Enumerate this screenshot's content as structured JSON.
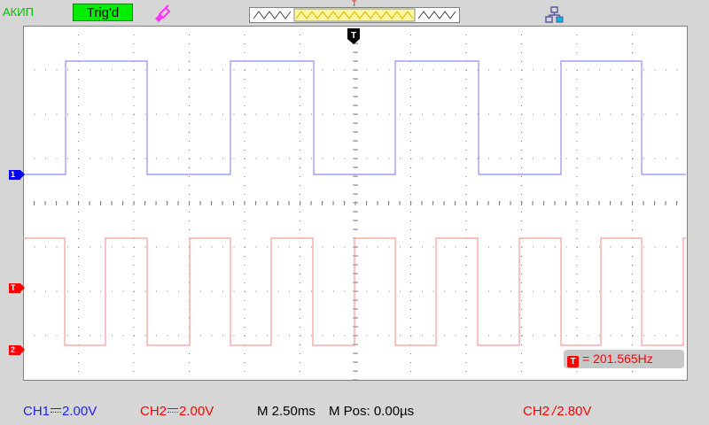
{
  "header": {
    "mode": "АКИП",
    "trigger_status": "Trig'd",
    "trigger_position_marker": "T"
  },
  "screen": {
    "channel_markers": {
      "ch1": "1",
      "trigger": "T",
      "ch2": "2"
    },
    "trigger_pointer": "T"
  },
  "frequency": {
    "icon": "T",
    "value": "= 201.565Hz"
  },
  "status": {
    "ch1_label": "CH1",
    "ch1_scale": "2.00V",
    "ch2_label": "CH2",
    "ch2_scale": "2.00V",
    "timebase": "M 2.50ms",
    "mpos": "M Pos: 0.00µs",
    "trigger_source": "CH2",
    "trigger_level": "2.80V"
  },
  "colors": {
    "ch1": "#8c8cff",
    "ch2": "#ff9a9a",
    "grid": "#808080",
    "brand": "#00c000",
    "accent_red": "#ff0000"
  },
  "icons": [
    "probe-icon",
    "network-icon",
    "trigger-pointer-icon",
    "memory-bar"
  ]
}
